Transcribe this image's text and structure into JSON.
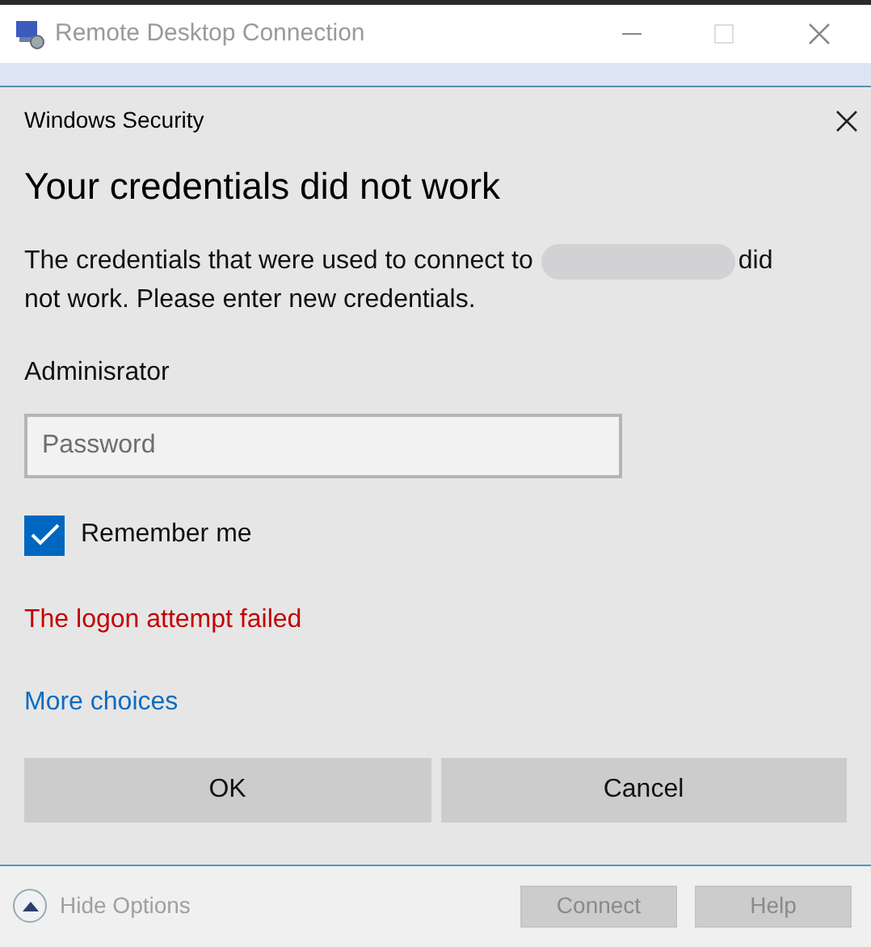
{
  "window": {
    "title": "Remote Desktop Connection"
  },
  "dialog": {
    "title": "Windows Security",
    "heading": "Your credentials did not work",
    "message_start": "The credentials that were used to connect to",
    "message_after": "did",
    "message_end": "not work. Please enter new credentials.",
    "username": "Adminisrator",
    "password": {
      "placeholder": "Password"
    },
    "remember": {
      "label": "Remember me",
      "checked": true
    },
    "error": "The logon attempt failed",
    "more": "More choices",
    "buttons": [
      "OK",
      "Cancel"
    ]
  },
  "footer": {
    "options": {
      "label": "Hide Options",
      "expanded": true
    },
    "buttons": [
      {
        "label": "Connect",
        "disabled": true
      },
      {
        "label": "Help",
        "disabled": true
      }
    ]
  }
}
